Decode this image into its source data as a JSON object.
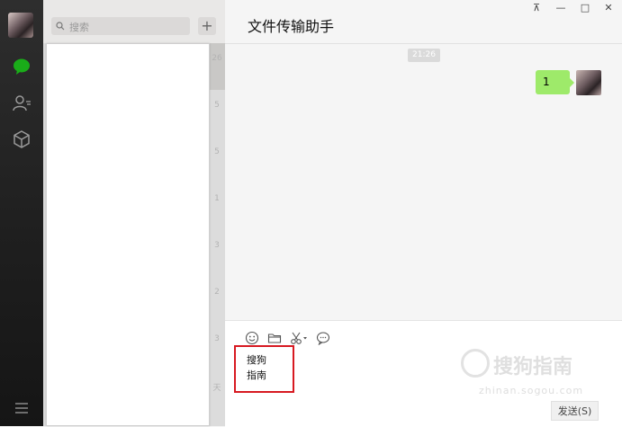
{
  "sidebar": {
    "icons": [
      "avatar",
      "chat-icon",
      "contacts-icon",
      "cube-icon",
      "menu-icon"
    ],
    "active_color": "#1aad19"
  },
  "search": {
    "placeholder": "搜索",
    "add_label": "+"
  },
  "chat_list": {
    "time_stubs": [
      "26",
      "5",
      "5",
      "1",
      "3",
      "2",
      "3",
      "天"
    ]
  },
  "window_controls": {
    "pin": "⊼",
    "minimize": "—",
    "maximize": "□",
    "close": "✕"
  },
  "conversation": {
    "title": "文件传输助手",
    "timestamp": "21:26",
    "messages": [
      {
        "text": "1",
        "from": "me"
      }
    ]
  },
  "composer": {
    "lines": [
      "搜狗",
      "指南"
    ],
    "send_label": "发送(S)"
  },
  "watermark": {
    "text": "搜狗指南",
    "url": "zhinan.sogou.com"
  },
  "colors": {
    "bubble": "#9eea6a",
    "highlight_box": "#d71921"
  }
}
